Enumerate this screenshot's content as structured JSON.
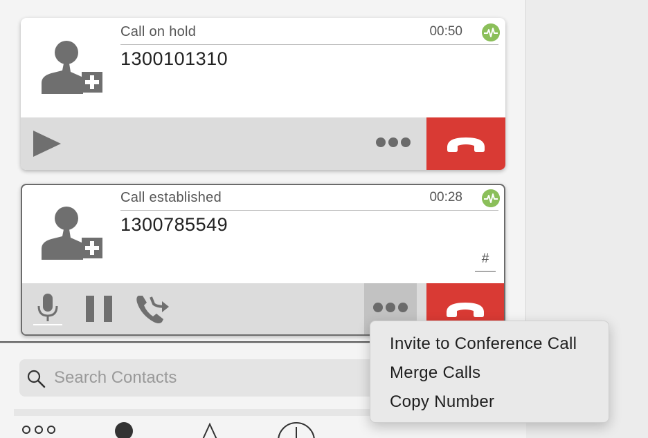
{
  "calls": [
    {
      "status": "Call on hold",
      "duration": "00:50",
      "number": "1300101310",
      "state": "hold"
    },
    {
      "status": "Call established",
      "duration": "00:28",
      "number": "1300785549",
      "state": "active",
      "dtmf_label": "#"
    }
  ],
  "colors": {
    "hangup": "#d93a34",
    "quality": "#8bbf5a",
    "toolbar": "#dcdcdc"
  },
  "search": {
    "placeholder": "Search Contacts"
  },
  "context_menu": {
    "items": [
      {
        "label": "Invite to Conference Call"
      },
      {
        "label": "Merge Calls"
      },
      {
        "label": "Copy Number"
      }
    ]
  },
  "icons": {
    "avatar": "add-contact-icon",
    "quality": "call-quality-icon",
    "resume": "play-icon",
    "more": "more-dots-icon",
    "hangup": "hang-up-icon",
    "mute": "microphone-icon",
    "hold": "pause-icon",
    "transfer": "call-transfer-icon",
    "search": "search-icon"
  }
}
